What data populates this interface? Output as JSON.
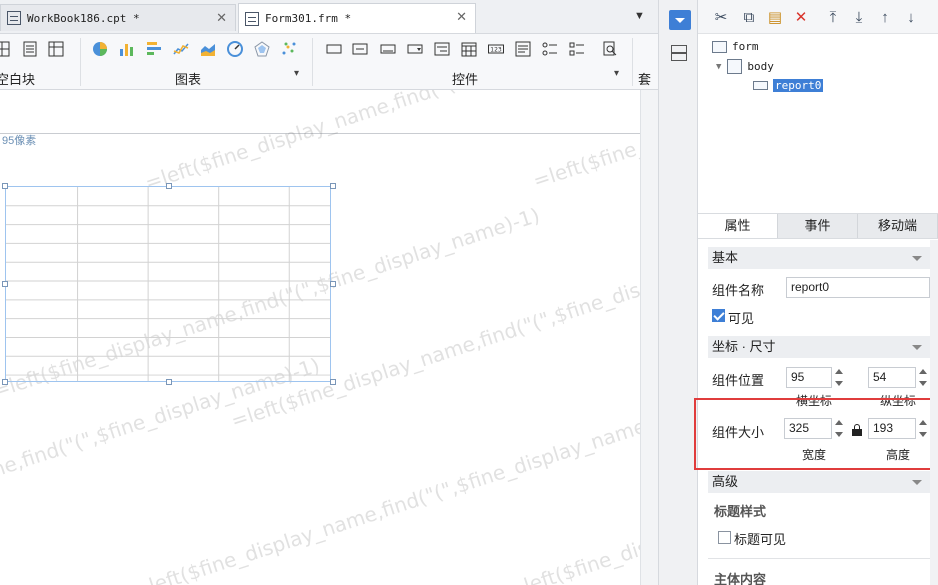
{
  "tabs": [
    {
      "label": "WorkBook186.cpt *",
      "active": false
    },
    {
      "label": "Form301.frm *",
      "active": true
    }
  ],
  "ribbon": {
    "groups": [
      {
        "label": "空白块"
      },
      {
        "label": "图表"
      },
      {
        "label": "控件"
      },
      {
        "label": "套用"
      }
    ]
  },
  "canvas": {
    "pixel_label": "95像素",
    "watermark_text": "=left($fine_display_name,find(\"(\",$fine_display_name)-1)"
  },
  "tree": {
    "nodes": [
      {
        "label": "form"
      },
      {
        "label": "body"
      },
      {
        "label": "report0"
      }
    ]
  },
  "panel_tabs": [
    {
      "label": "属性",
      "active": true
    },
    {
      "label": "事件",
      "active": false
    },
    {
      "label": "移动端",
      "active": false
    }
  ],
  "props": {
    "basic_section": "基本",
    "name_label": "组件名称",
    "name_value": "report0",
    "visible_label": "可见",
    "visible_checked": true,
    "geometry_section": "坐标 · 尺寸",
    "position_label": "组件位置",
    "pos_x": "95",
    "pos_y": "54",
    "pos_x_caption": "横坐标",
    "pos_y_caption": "纵坐标",
    "size_label": "组件大小",
    "width": "325",
    "height": "193",
    "width_caption": "宽度",
    "height_caption": "高度",
    "advanced_section": "高级",
    "title_style_label": "标题样式",
    "title_visible_label": "标题可见",
    "title_visible_checked": false,
    "body_content_label": "主体内容"
  },
  "colors": {
    "accent": "#3e7fd6",
    "highlight": "#e03c3c",
    "selection_border": "#9ec4ef"
  }
}
